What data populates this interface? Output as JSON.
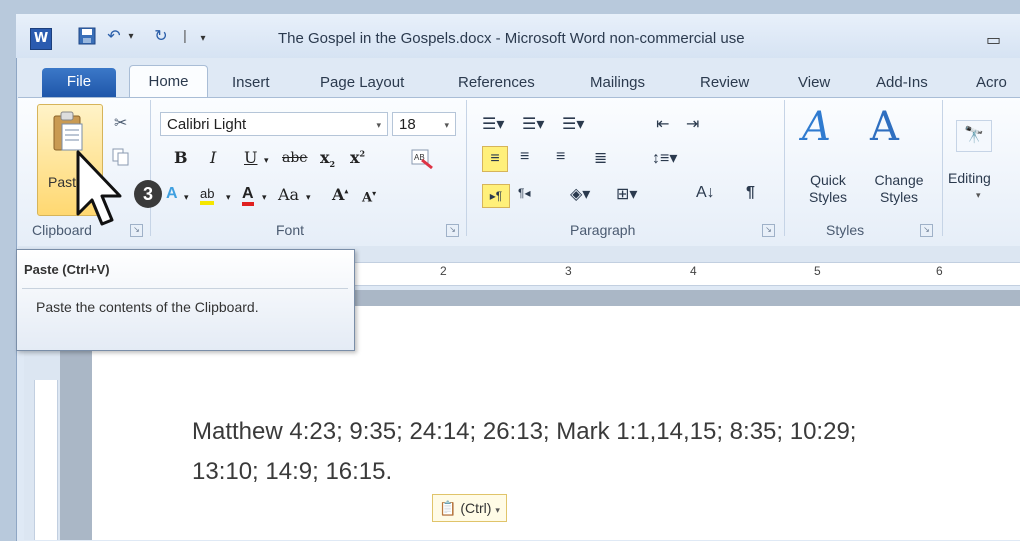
{
  "window": {
    "title": "The Gospel in the Gospels.docx - Microsoft Word non-commercial use"
  },
  "quick_access": {
    "save_icon": "save-icon",
    "undo_icon": "undo-icon",
    "redo_icon": "redo-icon"
  },
  "tabs": [
    {
      "label": "File"
    },
    {
      "label": "Home"
    },
    {
      "label": "Insert"
    },
    {
      "label": "Page Layout"
    },
    {
      "label": "References"
    },
    {
      "label": "Mailings"
    },
    {
      "label": "Review"
    },
    {
      "label": "View"
    },
    {
      "label": "Add-Ins"
    },
    {
      "label": "Acro"
    }
  ],
  "ribbon": {
    "clipboard": {
      "paste_label": "Paste",
      "group_label": "Clipboard"
    },
    "font": {
      "name": "Calibri Light",
      "size": "18",
      "group_label": "Font",
      "bold": "B",
      "italic": "I",
      "underline": "U",
      "strike": "abe",
      "sub": "x",
      "sup": "x",
      "aa": "Aa"
    },
    "paragraph": {
      "group_label": "Paragraph"
    },
    "styles": {
      "quick_label": "Quick Styles",
      "quick_dd": "▾",
      "change_label": "Change Styles",
      "group_label": "Styles"
    },
    "editing": {
      "label": "Editing"
    }
  },
  "ruler_numbers": [
    "2",
    "3",
    "4",
    "5",
    "6"
  ],
  "tooltip": {
    "title": "Paste (Ctrl+V)",
    "description": "Paste the contents of the Clipboard."
  },
  "step_badge": "3",
  "document": {
    "line1": "Matthew 4:23; 9:35; 24:14; 26:13; Mark 1:1,14,15; 8:35; 10:29;",
    "line2": "13:10; 14:9; 16:15."
  },
  "paste_options": {
    "label": "(Ctrl)"
  },
  "colors": {
    "accent": "#2a5bb0",
    "file_tab": "#2a63b8",
    "paste_highlight": "#ffd871"
  }
}
